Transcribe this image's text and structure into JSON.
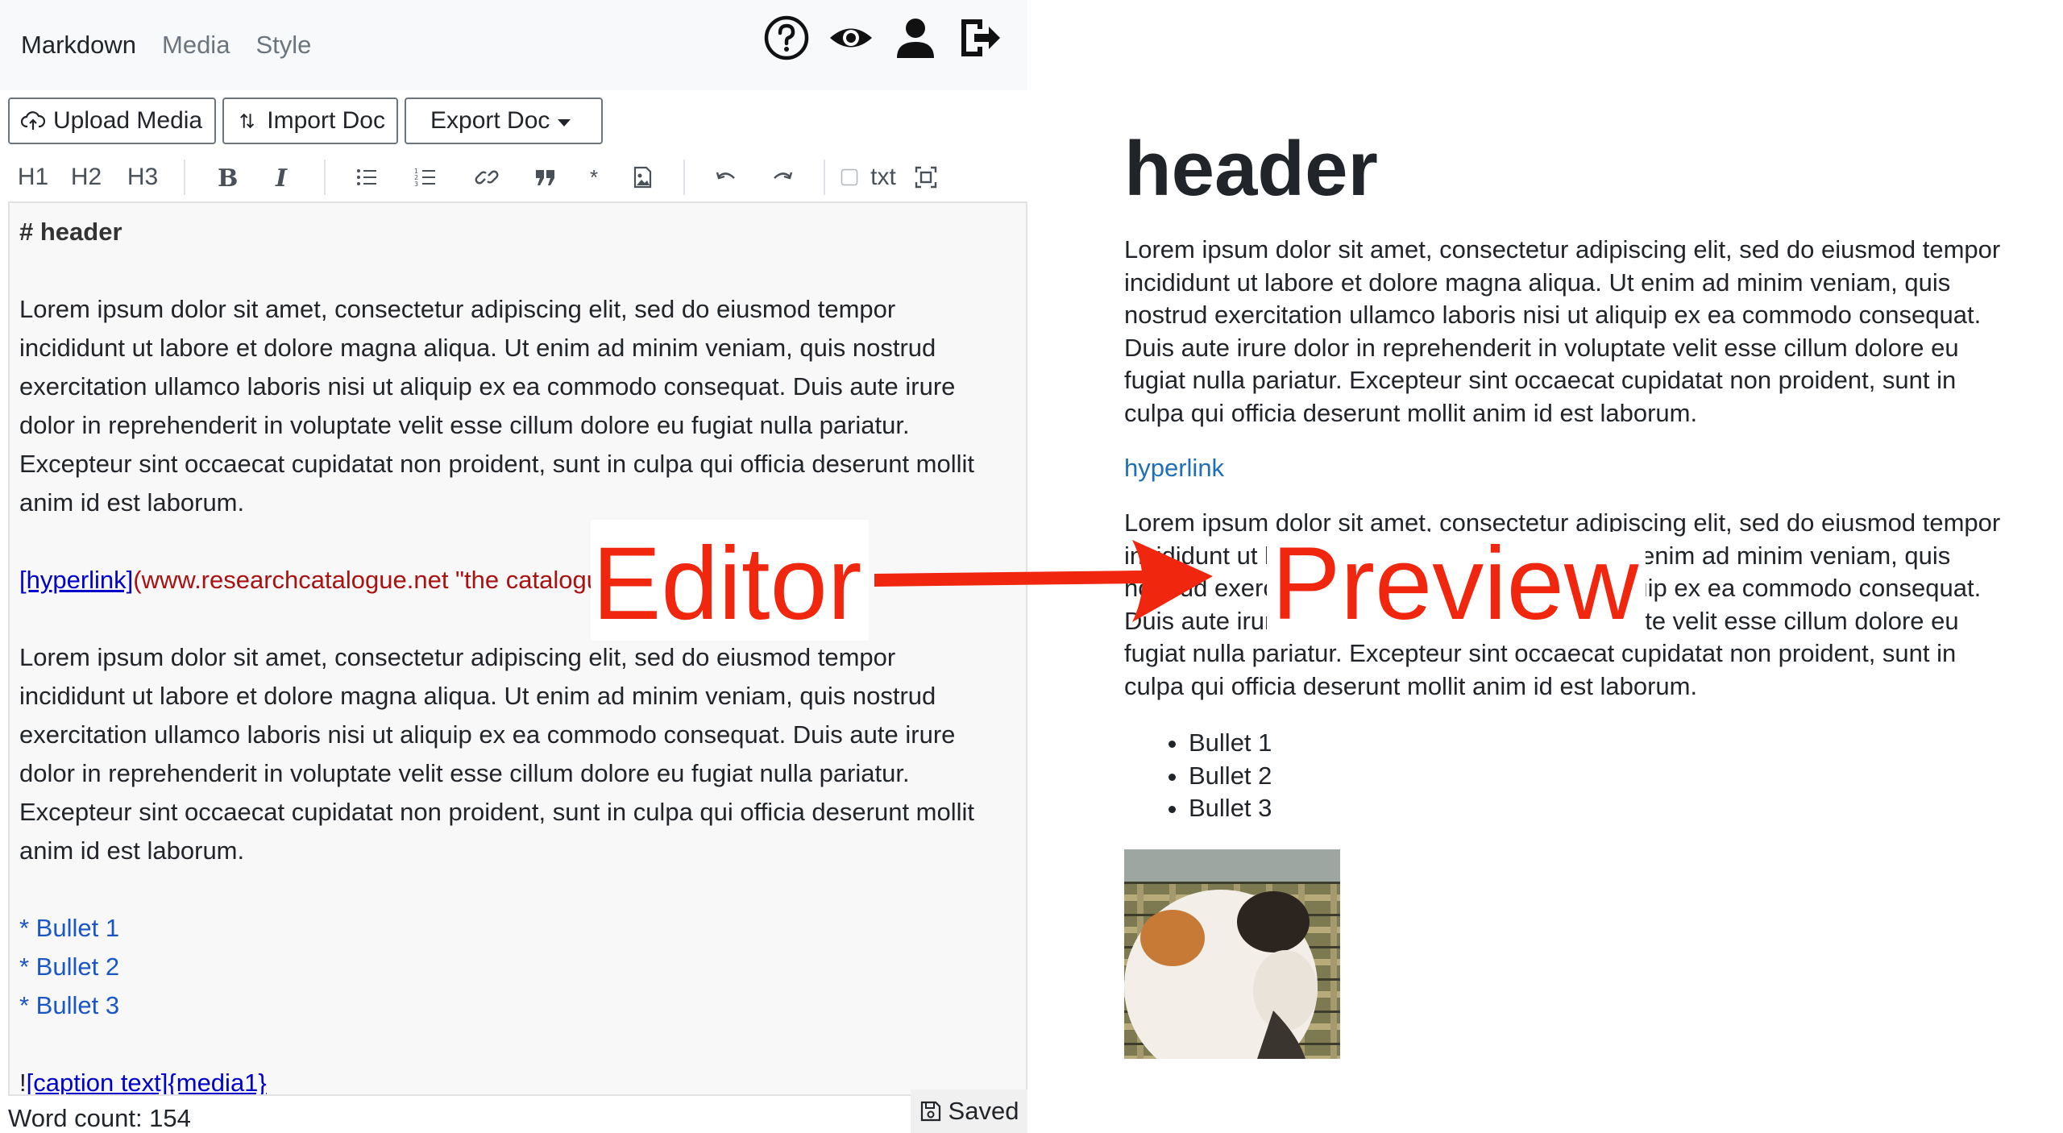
{
  "nav": {
    "tabs": [
      {
        "label": "Markdown",
        "active": true
      },
      {
        "label": "Media",
        "active": false
      },
      {
        "label": "Style",
        "active": false
      }
    ],
    "icons": [
      "help-icon",
      "eye-icon",
      "user-icon",
      "logout-icon"
    ]
  },
  "actions": {
    "upload": "Upload Media",
    "import": "Import Doc",
    "export": "Export Doc"
  },
  "toolbar": {
    "h1": "H1",
    "h2": "H2",
    "h3": "H3",
    "txt": "txt"
  },
  "editor": {
    "header": "# header",
    "para1": [
      "Lorem ipsum dolor sit amet, consectetur adipiscing elit, sed do eiusmod tempor",
      "incididunt ut labore et dolore magna aliqua. Ut enim ad minim veniam, quis nostrud",
      "exercitation ullamco laboris nisi ut aliquip ex ea commodo consequat. Duis aute irure",
      "dolor in reprehenderit in voluptate velit esse cillum dolore eu fugiat nulla pariatur.",
      "Excepteur sint occaecat cupidatat non proident, sunt in culpa qui officia deserunt mollit",
      "anim id est laborum."
    ],
    "link_text": "[hyperlink]",
    "link_url": "(www.researchcatalogue.net \"the catalogue\")",
    "para2": [
      "Lorem ipsum dolor sit amet, consectetur adipiscing elit, sed do eiusmod tempor",
      "incididunt ut labore et dolore magna aliqua. Ut enim ad minim veniam, quis nostrud",
      "exercitation ullamco laboris nisi ut aliquip ex ea commodo consequat. Duis aute irure",
      "dolor in reprehenderit in voluptate velit esse cillum dolore eu fugiat nulla pariatur.",
      "Excepteur sint occaecat cupidatat non proident, sunt in culpa qui officia deserunt mollit",
      "anim id est laborum."
    ],
    "bullets": [
      "* Bullet 1",
      "* Bullet 2",
      "* Bullet 3"
    ],
    "media_prefix": "!",
    "media_ref": "[caption text]{media1}"
  },
  "status": {
    "word_count": "Word count: 154",
    "saved": "Saved"
  },
  "preview": {
    "heading": "header",
    "para1": "Lorem ipsum dolor sit amet, consectetur adipiscing elit, sed do eiusmod tempor incididunt ut labore et dolore magna aliqua. Ut enim ad minim veniam, quis nostrud exercitation ullamco laboris nisi ut aliquip ex ea commodo consequat. Duis aute irure dolor in reprehenderit in voluptate velit esse cillum dolore eu fugiat nulla pariatur. Excepteur sint occaecat cupidatat non proident, sunt in culpa qui officia deserunt mollit anim id est laborum.",
    "link": "hyperlink",
    "para2": "Lorem ipsum dolor sit amet, consectetur adipiscing elit, sed do eiusmod tempor incididunt ut labore et dolore magna aliqua. Ut enim ad minim veniam, quis nostrud exercitation ullamco laboris nisi ut aliquip ex ea commodo consequat. Duis aute irure dolor in reprehenderit in voluptate velit esse cillum dolore eu fugiat nulla pariatur. Excepteur sint occaecat cupidatat non proident, sunt in culpa qui officia deserunt mollit anim id est laborum.",
    "bullets": [
      "Bullet 1",
      "Bullet 2",
      "Bullet 3"
    ]
  },
  "annotations": {
    "editor": "Editor",
    "preview": "Preview",
    "color": "#f1260f"
  }
}
